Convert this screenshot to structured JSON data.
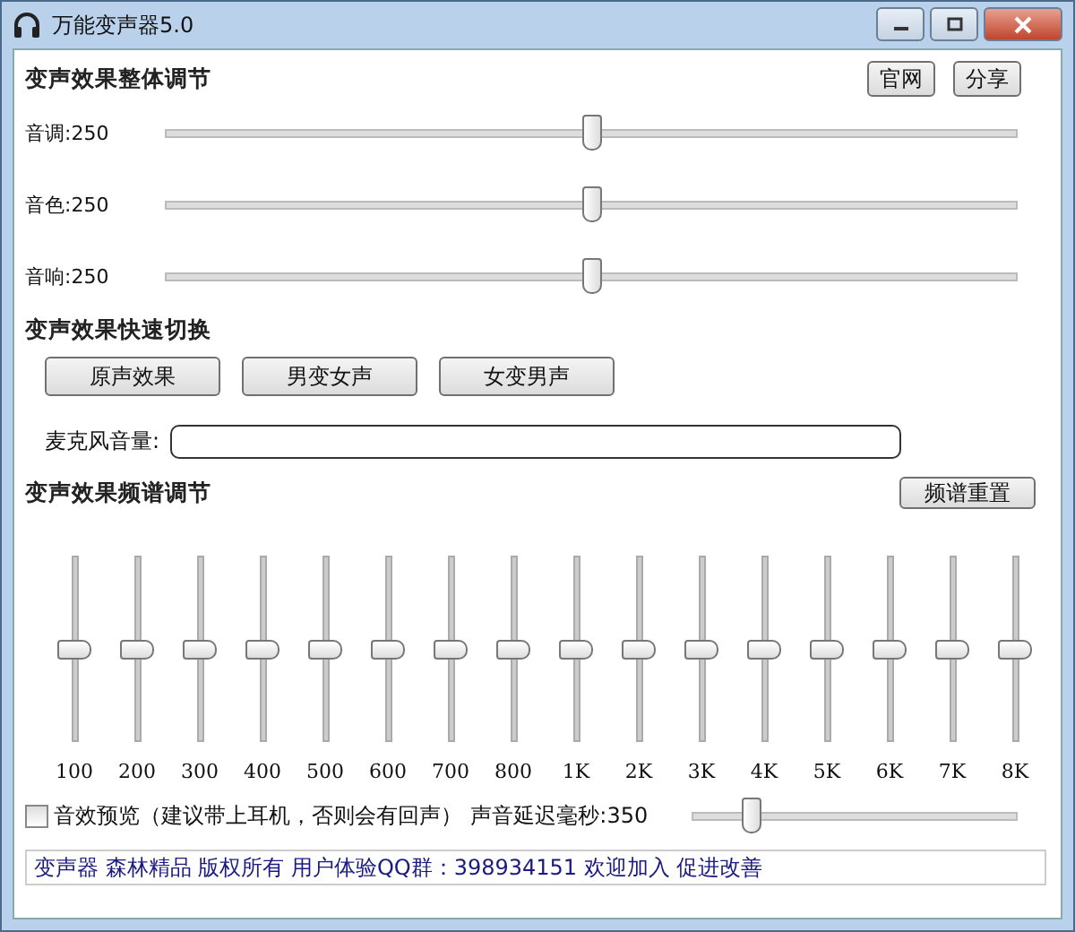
{
  "window": {
    "title": "万能变声器5.0"
  },
  "overall": {
    "heading": "变声效果整体调节",
    "buttons": [
      "官网",
      "分享"
    ],
    "sliders": [
      {
        "label": "音调:250",
        "level": 0.5
      },
      {
        "label": "音色:250",
        "level": 0.5
      },
      {
        "label": "音响:250",
        "level": 0.5
      }
    ]
  },
  "quick_switch": {
    "heading": "变声效果快速切换",
    "buttons": [
      "原声效果",
      "男变女声",
      "女变男声"
    ]
  },
  "mic_volume": {
    "label": "麦克风音量:",
    "level": 0
  },
  "spectrum": {
    "heading": "变声效果频谱调节",
    "reset_button": "频谱重置",
    "bands": [
      {
        "label": "100",
        "level": 0.5
      },
      {
        "label": "200",
        "level": 0.5
      },
      {
        "label": "300",
        "level": 0.5
      },
      {
        "label": "400",
        "level": 0.5
      },
      {
        "label": "500",
        "level": 0.5
      },
      {
        "label": "600",
        "level": 0.5
      },
      {
        "label": "700",
        "level": 0.5
      },
      {
        "label": "800",
        "level": 0.5
      },
      {
        "label": "1K",
        "level": 0.5
      },
      {
        "label": "2K",
        "level": 0.5
      },
      {
        "label": "3K",
        "level": 0.5
      },
      {
        "label": "4K",
        "level": 0.5
      },
      {
        "label": "5K",
        "level": 0.5
      },
      {
        "label": "6K",
        "level": 0.5
      },
      {
        "label": "7K",
        "level": 0.5
      },
      {
        "label": "8K",
        "level": 0.5
      }
    ]
  },
  "preview": {
    "label": "音效预览（建议带上耳机，否则会有回声）",
    "checked": false
  },
  "delay": {
    "label": "声音延迟毫秒:350",
    "level": 0.18
  },
  "status_bar": "变声器 森林精品 版权所有 用户体验QQ群：398934151 欢迎加入 促进改善"
}
